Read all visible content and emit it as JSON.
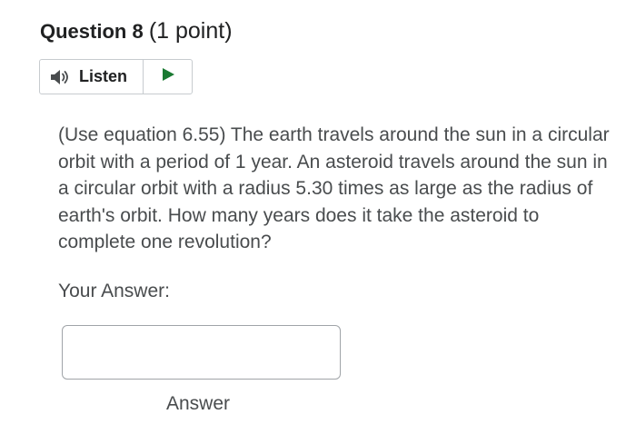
{
  "question": {
    "title": "Question 8",
    "points": "(1 point)",
    "text": "(Use equation 6.55) The earth travels around the sun in a circular orbit with a period of 1 year. An asteroid travels around the sun in a circular orbit with a radius 5.30 times as large as the radius of earth's orbit. How many years does it take the asteroid to complete one revolution?"
  },
  "listen": {
    "label": "Listen",
    "speaker_icon": "speaker-icon",
    "play_icon": "play-icon",
    "play_color": "#1a7a32"
  },
  "answer": {
    "label": "Your Answer:",
    "value": "",
    "caption": "Answer"
  }
}
